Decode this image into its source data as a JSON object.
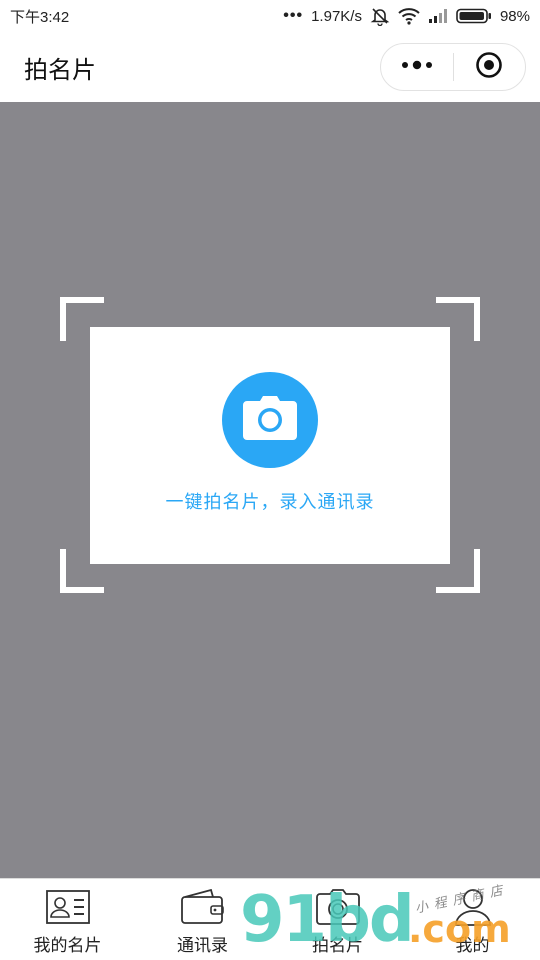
{
  "status_bar": {
    "time": "下午3:42",
    "dots": "•••",
    "speed": "1.97K/s",
    "battery_pct": "98%",
    "battery_level": 0.98
  },
  "nav": {
    "title": "拍名片"
  },
  "card": {
    "prompt": "一键拍名片，录入通讯录"
  },
  "tabs": [
    {
      "label": "我的名片",
      "icon": "business-card-icon"
    },
    {
      "label": "通讯录",
      "icon": "wallet-icon"
    },
    {
      "label": "拍名片",
      "icon": "camera-icon"
    },
    {
      "label": "我的",
      "icon": "user-icon"
    }
  ],
  "watermark": {
    "digits": "91bd",
    "domain": ".com",
    "sub": "小程序商店"
  },
  "colors": {
    "accent": "#2aa7f5",
    "overlay": "#88878c",
    "watermark_teal": "#48c8b9",
    "watermark_orange": "#f5a028"
  }
}
